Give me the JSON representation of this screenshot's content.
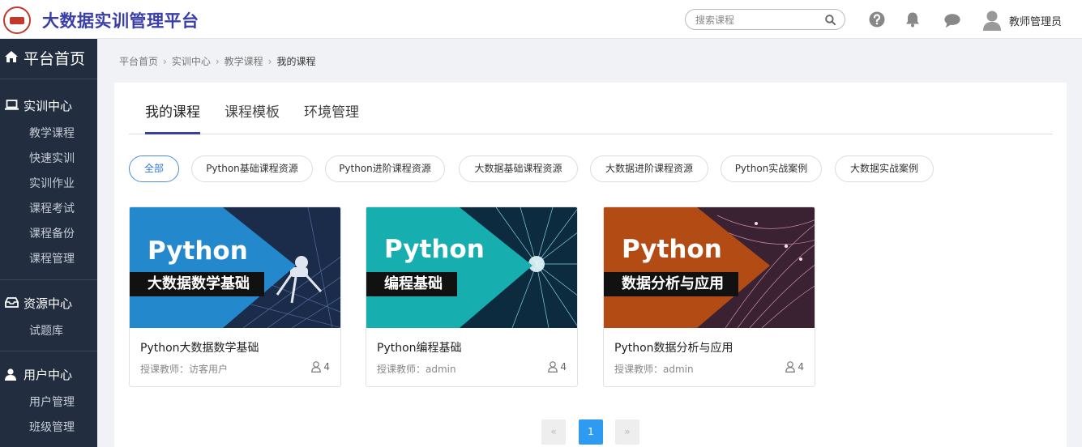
{
  "header": {
    "app_title": "大数据实训管理平台",
    "search_placeholder": "搜索课程",
    "user_name": "教师管理员"
  },
  "sidebar": {
    "home_label": "平台首页",
    "groups": [
      {
        "label": "实训中心",
        "icon": "laptop-icon",
        "items": [
          "教学课程",
          "快速实训",
          "实训作业",
          "课程考试",
          "课程备份",
          "课程管理"
        ]
      },
      {
        "label": "资源中心",
        "icon": "inbox-icon",
        "items": [
          "试题库"
        ]
      },
      {
        "label": "用户中心",
        "icon": "user-icon",
        "items": [
          "用户管理",
          "班级管理"
        ]
      }
    ]
  },
  "breadcrumb": [
    "平台首页",
    "实训中心",
    "教学课程",
    "我的课程"
  ],
  "tabs": [
    "我的课程",
    "课程模板",
    "环境管理"
  ],
  "filters": [
    "全部",
    "Python基础课程资源",
    "Python进阶课程资源",
    "大数据基础课程资源",
    "大数据进阶课程资源",
    "Python实战案例",
    "大数据实战案例"
  ],
  "courses": [
    {
      "cover_title": "Python",
      "cover_subtitle": "大数据数学基础",
      "title": "Python大数据数学基础",
      "teacher": "授课教师：访客用户",
      "students": "4",
      "theme_color": "#2488cc",
      "bg_color": "#1b2b4a"
    },
    {
      "cover_title": "Python",
      "cover_subtitle": "编程基础",
      "title": "Python编程基础",
      "teacher": "授课教师：admin",
      "students": "4",
      "theme_color": "#17aeb0",
      "bg_color": "#0c2b3e"
    },
    {
      "cover_title": "Python",
      "cover_subtitle": "数据分析与应用",
      "title": "Python数据分析与应用",
      "teacher": "授课教师：admin",
      "students": "4",
      "theme_color": "#b24c14",
      "bg_color": "#3a2233"
    }
  ],
  "pagination": {
    "prev": "«",
    "current": "1",
    "next": "»"
  }
}
